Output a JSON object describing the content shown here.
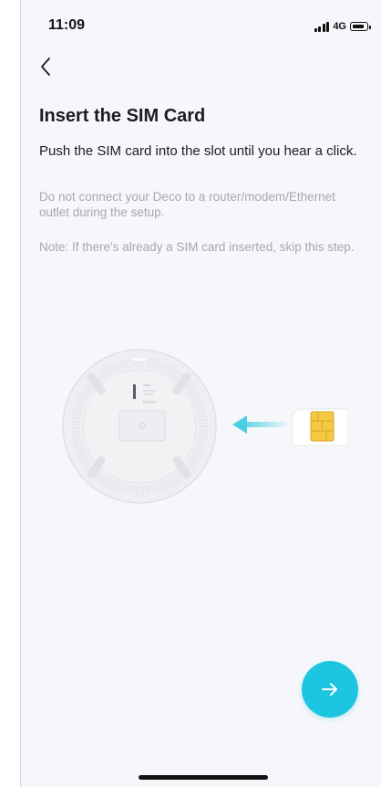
{
  "status_bar": {
    "time": "11:09",
    "network": "4G",
    "icons": [
      "signal-bars-icon",
      "battery-icon"
    ]
  },
  "nav": {
    "back_icon": "chevron-left-icon"
  },
  "content": {
    "title": "Insert the SIM Card",
    "instruction": "Push the SIM card into the slot until you hear a click.",
    "warning": "Do not connect your Deco to a router/modem/Ethernet outlet during the setup.",
    "note": "Note: If there's already a SIM card inserted, skip this step."
  },
  "illustration": {
    "device": "deco-device-illustration",
    "arrow": "insert-arrow-icon",
    "sim": "sim-card-illustration",
    "device_label_small": "RESET"
  },
  "actions": {
    "next_icon": "arrow-right-icon"
  },
  "colors": {
    "accent": "#1cc6e0",
    "background": "#f6f7fb",
    "title": "#1c1c1e",
    "muted_text": "#a6a8ad",
    "sim_chip": "#f5c842"
  }
}
